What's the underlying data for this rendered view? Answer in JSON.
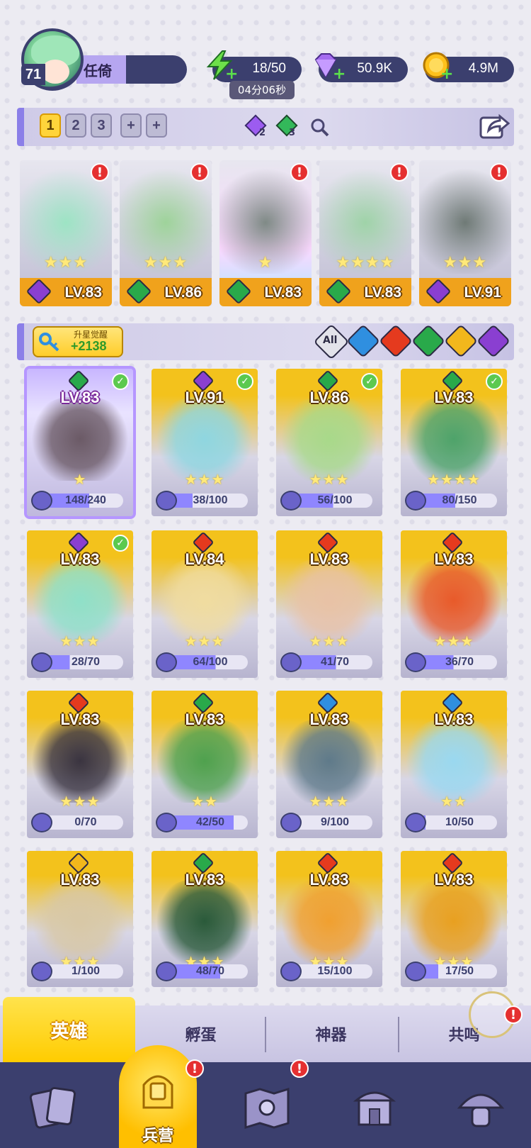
{
  "player": {
    "level": "71",
    "name": "任倚"
  },
  "resources": {
    "stamina": "18/50",
    "stamina_timer": "04分06秒",
    "gems": "50.9K",
    "gold": "4.9M"
  },
  "team": {
    "slots": [
      "1",
      "2",
      "3",
      "+",
      "+"
    ],
    "gem_purple_count": "2",
    "gem_green_count": "3",
    "icons": [
      "search-icon",
      "share-icon"
    ]
  },
  "team_members": [
    {
      "level": "LV.83",
      "element": "dark",
      "stars": "★★★",
      "alert": "!"
    },
    {
      "level": "LV.86",
      "element": "wind",
      "stars": "★★★",
      "alert": "!"
    },
    {
      "level": "LV.83",
      "element": "wind",
      "stars": "★",
      "alert": "!"
    },
    {
      "level": "LV.83",
      "element": "wind",
      "stars": "★★★★",
      "alert": "!"
    },
    {
      "level": "LV.91",
      "element": "dark",
      "stars": "★★★",
      "alert": "!"
    }
  ],
  "upgrade": {
    "label": "升星觉醒",
    "value": "+2138"
  },
  "filters": {
    "all_label": "All",
    "elements": [
      "water",
      "fire",
      "wind",
      "light",
      "dark"
    ]
  },
  "colors": {
    "water": "#2f8fe0",
    "fire": "#e53a1e",
    "wind": "#29a94a",
    "light": "#f2b71c",
    "dark": "#8a3fd1",
    "accent": "#ffcc00",
    "nav_bg": "#3b3f6e"
  },
  "heroes": [
    {
      "level": "LV.83",
      "element": "wind",
      "stars": "★",
      "shards": "148/240",
      "shard_fraction": 0.62,
      "check": true,
      "selected": true
    },
    {
      "level": "LV.91",
      "element": "dark",
      "stars": "★★★",
      "shards": "38/100",
      "shard_fraction": 0.38,
      "check": true
    },
    {
      "level": "LV.86",
      "element": "wind",
      "stars": "★★★",
      "shards": "56/100",
      "shard_fraction": 0.56,
      "check": true
    },
    {
      "level": "LV.83",
      "element": "wind",
      "stars": "★★★★",
      "shards": "80/150",
      "shard_fraction": 0.53,
      "check": true
    },
    {
      "level": "LV.83",
      "element": "dark",
      "stars": "★★★",
      "shards": "28/70",
      "shard_fraction": 0.4,
      "check": true
    },
    {
      "level": "LV.84",
      "element": "fire",
      "stars": "★★★",
      "shards": "64/100",
      "shard_fraction": 0.64,
      "check": false
    },
    {
      "level": "LV.83",
      "element": "fire",
      "stars": "★★★",
      "shards": "41/70",
      "shard_fraction": 0.59,
      "check": false
    },
    {
      "level": "LV.83",
      "element": "fire",
      "stars": "★★★",
      "shards": "36/70",
      "shard_fraction": 0.51,
      "check": false
    },
    {
      "level": "LV.83",
      "element": "fire",
      "stars": "★★★",
      "shards": "0/70",
      "shard_fraction": 0,
      "check": false
    },
    {
      "level": "LV.83",
      "element": "wind",
      "stars": "★★",
      "shards": "42/50",
      "shard_fraction": 0.84,
      "check": false
    },
    {
      "level": "LV.83",
      "element": "water",
      "stars": "★★★",
      "shards": "9/100",
      "shard_fraction": 0.09,
      "check": false
    },
    {
      "level": "LV.83",
      "element": "water",
      "stars": "★★",
      "shards": "10/50",
      "shard_fraction": 0.2,
      "check": false
    },
    {
      "level": "LV.83",
      "element": "light",
      "stars": "★★★",
      "shards": "1/100",
      "shard_fraction": 0.01,
      "check": false
    },
    {
      "level": "LV.83",
      "element": "wind",
      "stars": "★★★",
      "shards": "48/70",
      "shard_fraction": 0.69,
      "check": false
    },
    {
      "level": "LV.83",
      "element": "fire",
      "stars": "★★★",
      "shards": "15/100",
      "shard_fraction": 0.15,
      "check": false
    },
    {
      "level": "LV.83",
      "element": "fire",
      "stars": "★★★",
      "shards": "17/50",
      "shard_fraction": 0.34,
      "check": false
    }
  ],
  "subtabs": [
    "英雄",
    "孵蛋",
    "神器",
    "共鸣"
  ],
  "nav": {
    "active_label": "兵营",
    "items": [
      "cards-icon",
      "barracks-icon",
      "map-icon",
      "shrine-icon",
      "mushroom-icon"
    ],
    "alert": "!"
  }
}
